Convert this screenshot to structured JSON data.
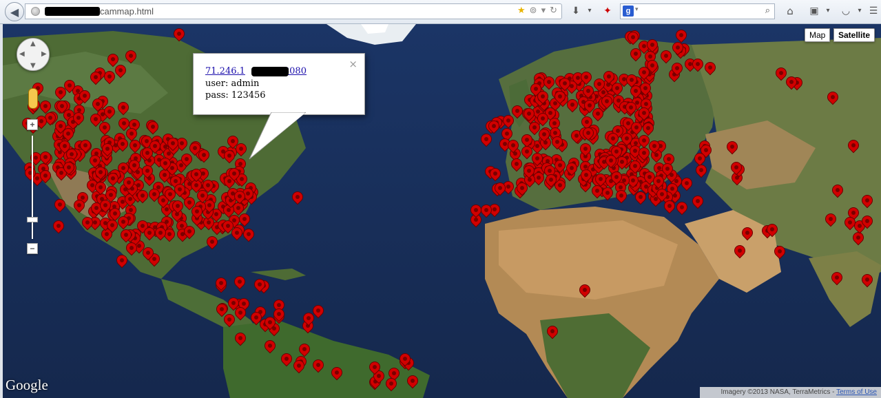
{
  "browser": {
    "url_suffix": "cammap.html",
    "icons": [
      "back-arrow-icon",
      "globe-icon",
      "star-icon",
      "bookmark-icon",
      "reload-icon",
      "download-icon",
      "addon-icon",
      "google-search-icon",
      "search-icon",
      "home-icon",
      "bookmarks-menu-icon",
      "pocket-icon",
      "menu-icon"
    ]
  },
  "map": {
    "type_buttons": {
      "map": "Map",
      "satellite": "Satellite"
    },
    "zoom_in": "+",
    "zoom_out": "−",
    "logo": "Google",
    "attribution": "Imagery ©2013 NASA, TerraMetrics - ",
    "terms": "Terms of Use",
    "pin_color": "#d10000"
  },
  "info_window": {
    "link_prefix": "71.246.1",
    "link_suffix": "8080",
    "user_line": "user: admin",
    "pass_line": "pass: 123456",
    "close": "×"
  }
}
